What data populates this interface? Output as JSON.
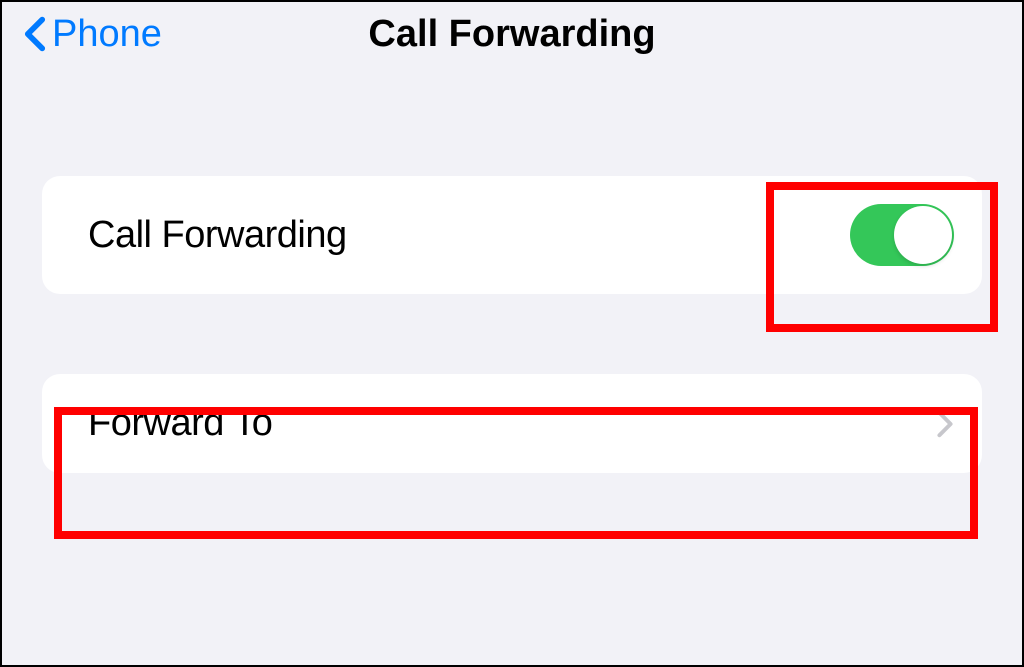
{
  "nav": {
    "back_label": "Phone",
    "title": "Call Forwarding"
  },
  "rows": {
    "call_forwarding_label": "Call Forwarding",
    "forward_to_label": "Forward To"
  },
  "toggle": {
    "on": true
  },
  "colors": {
    "accent": "#007aff",
    "toggle_on": "#34c759",
    "highlight": "#ff0000"
  }
}
